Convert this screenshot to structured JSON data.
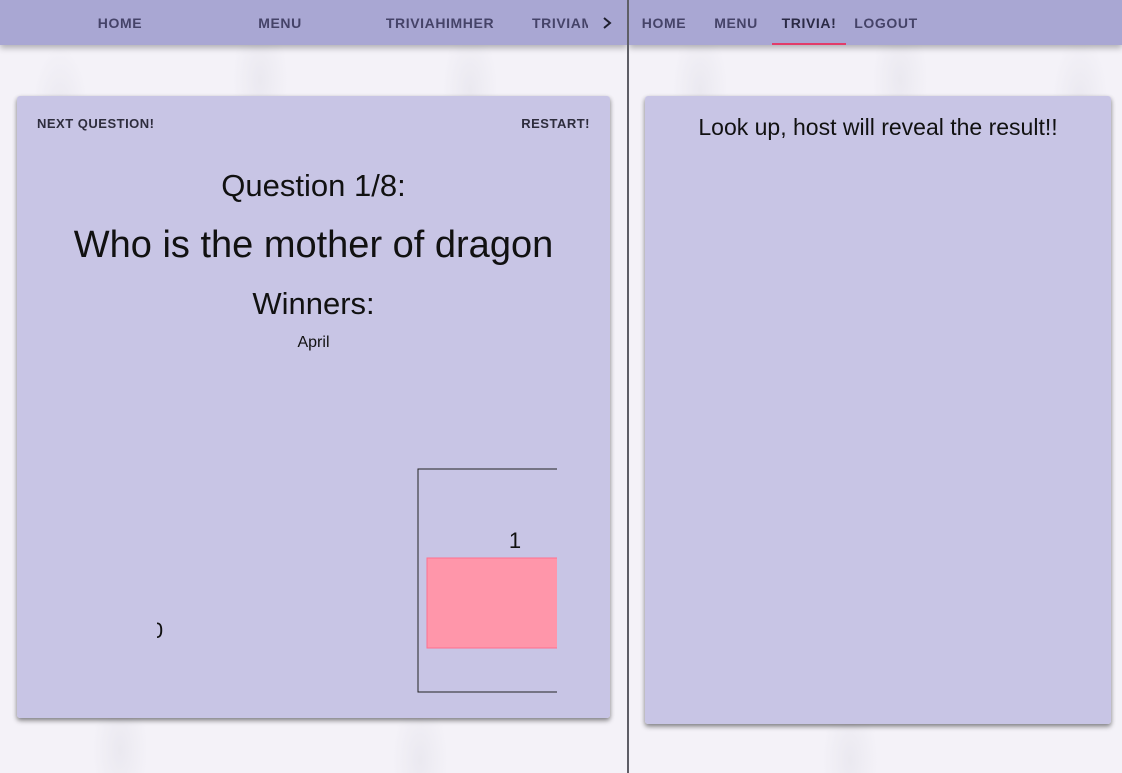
{
  "left": {
    "nav": {
      "tabs": [
        {
          "label": "HOME"
        },
        {
          "label": "MENU"
        },
        {
          "label": "TRIVIAHIMHER"
        },
        {
          "label": "TRIVIAM"
        }
      ]
    },
    "card": {
      "next_label": "NEXT QUESTION!",
      "restart_label": "RESTART!",
      "question_count": "Question 1/8:",
      "question_text": "Who is the mother of dragon",
      "winners_title": "Winners:",
      "winners": [
        "April"
      ]
    },
    "colors": {
      "bar_fill": "#ff96aa",
      "bar_border": "#ff6f8e"
    }
  },
  "right": {
    "nav": {
      "tabs": [
        {
          "label": "HOME"
        },
        {
          "label": "MENU"
        },
        {
          "label": "TRIVIA!",
          "active": true
        },
        {
          "label": "LOGOUT"
        }
      ]
    },
    "card": {
      "message": "Look up, host will reveal the result!!"
    }
  },
  "chart_data": {
    "type": "bar",
    "values": [
      0,
      1
    ],
    "title": "",
    "xlabel": "",
    "ylabel": ""
  },
  "theme": {
    "navbar": "#a9a7d3",
    "card": "#c6c3e4",
    "active_underline": "#e23c6a"
  }
}
